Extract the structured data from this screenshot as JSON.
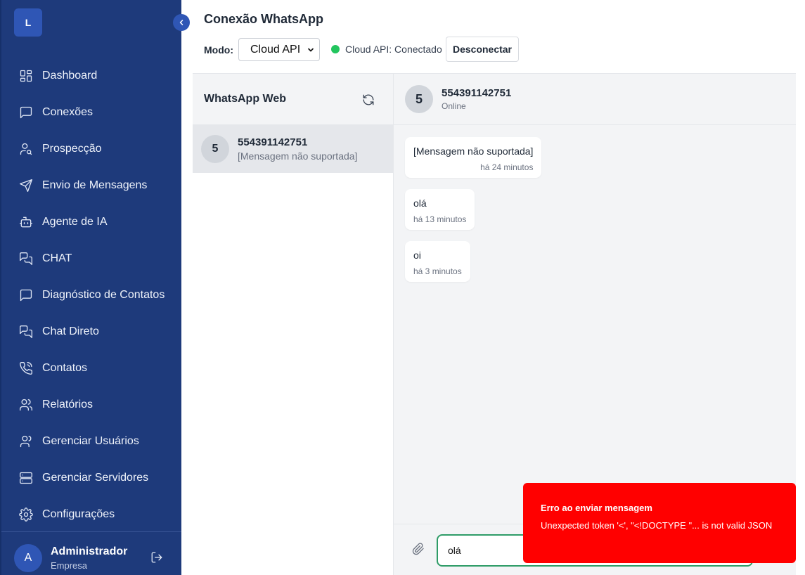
{
  "sidebar": {
    "logo_letter": "L",
    "items": [
      {
        "label": "Dashboard",
        "icon": "dashboard-icon"
      },
      {
        "label": "Conexões",
        "icon": "message-square-icon"
      },
      {
        "label": "Prospecção",
        "icon": "user-search-icon"
      },
      {
        "label": "Envio de Mensagens",
        "icon": "send-icon"
      },
      {
        "label": "Agente de IA",
        "icon": "bot-icon"
      },
      {
        "label": "CHAT",
        "icon": "messages-icon"
      },
      {
        "label": "Diagnóstico de Contatos",
        "icon": "message-square-icon"
      },
      {
        "label": "Chat Direto",
        "icon": "messages-icon"
      },
      {
        "label": "Contatos",
        "icon": "phone-call-icon"
      },
      {
        "label": "Relatórios",
        "icon": "users-icon"
      },
      {
        "label": "Gerenciar Usuários",
        "icon": "users-icon"
      },
      {
        "label": "Gerenciar Servidores",
        "icon": "server-icon"
      },
      {
        "label": "Configurações",
        "icon": "gear-icon"
      }
    ],
    "user": {
      "initial": "A",
      "name": "Administrador",
      "company": "Empresa"
    }
  },
  "header": {
    "title": "Conexão WhatsApp",
    "mode_label": "Modo:",
    "mode_value": "Cloud API",
    "status_text": "Cloud API: Conectado",
    "status_color": "#22c55e",
    "disconnect_label": "Desconectar"
  },
  "conversations": {
    "title": "WhatsApp Web",
    "items": [
      {
        "initial": "5",
        "name": "554391142751",
        "preview": "[Mensagem não suportada]"
      }
    ]
  },
  "chat": {
    "contact": {
      "initial": "5",
      "name": "554391142751",
      "status": "Online"
    },
    "messages": [
      {
        "text": "[Mensagem não suportada]",
        "time": "há 24 minutos"
      },
      {
        "text": "olá",
        "time": "há 13 minutos"
      },
      {
        "text": "oi",
        "time": "há 3 minutos"
      }
    ],
    "input_value": "olá"
  },
  "toast": {
    "title": "Erro ao enviar mensagem",
    "message": "Unexpected token '<', \"<!DOCTYPE \"... is not valid JSON",
    "color": "#ff0000"
  }
}
